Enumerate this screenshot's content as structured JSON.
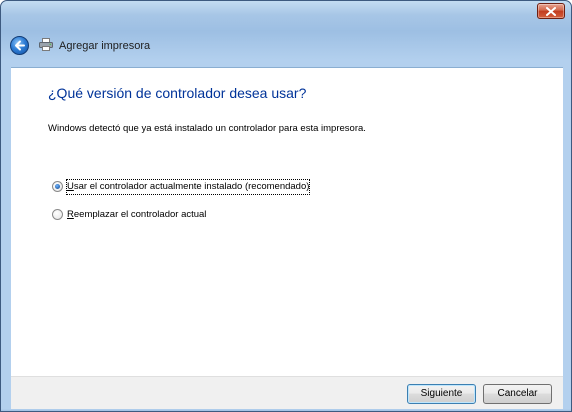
{
  "window": {
    "title": "Agregar impresora",
    "icons": {
      "back": "back-arrow-icon",
      "printer": "printer-icon",
      "close": "close-icon"
    },
    "colors": {
      "close_button": "#c13b1f",
      "heading": "#003399",
      "frame": "#a7c6e6"
    }
  },
  "wizard": {
    "heading": "¿Qué versión de controlador desea usar?",
    "description": "Windows detectó que ya está instalado un controlador para esta impresora.",
    "options": [
      {
        "accesskey": "U",
        "rest": "sar el controlador actualmente instalado (recomendado)",
        "selected": true
      },
      {
        "accesskey": "R",
        "rest": "eemplazar el controlador actual",
        "selected": false
      }
    ]
  },
  "buttons": {
    "next": "Siguiente",
    "cancel": "Cancelar"
  }
}
